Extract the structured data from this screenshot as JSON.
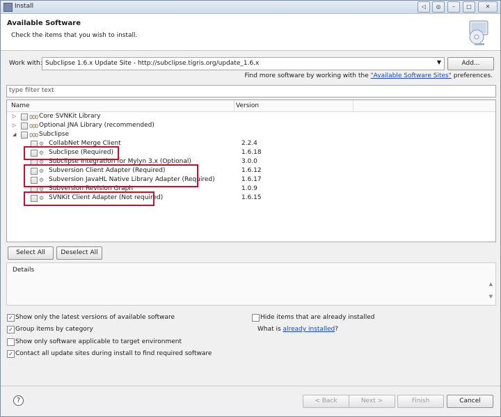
{
  "window": {
    "title": "Install"
  },
  "header": {
    "title": "Available Software",
    "subtitle": "Check the items that you wish to install."
  },
  "workwith": {
    "label": "Work with:",
    "value": "Subclipse 1.6.x Update Site - http://subclipse.tigris.org/update_1.6.x",
    "add_label": "Add..."
  },
  "findmore": {
    "prefix": "Find more software by working with the ",
    "link": "\"Available Software Sites\"",
    "suffix": " preferences."
  },
  "filter": {
    "placeholder": "type filter text"
  },
  "tree": {
    "col_name": "Name",
    "col_version": "Version",
    "rows": [
      {
        "name": "Core SVNKit Library",
        "version": ""
      },
      {
        "name": "Optional JNA Library (recommended)",
        "version": ""
      },
      {
        "name": "Subclipse",
        "version": ""
      },
      {
        "name": "CollabNet Merge Client",
        "version": "2.2.4"
      },
      {
        "name": "Subclipse (Required)",
        "version": "1.6.18"
      },
      {
        "name": "Subclipse Integration for Mylyn 3.x (Optional)",
        "version": "3.0.0"
      },
      {
        "name": "Subversion Client Adapter (Required)",
        "version": "1.6.12"
      },
      {
        "name": "Subversion JavaHL Native Library Adapter (Required)",
        "version": "1.6.17"
      },
      {
        "name": "Subversion Revision Graph",
        "version": "1.0.9"
      },
      {
        "name": "SVNKit Client Adapter (Not required)",
        "version": "1.6.15"
      }
    ]
  },
  "buttons": {
    "select_all": "Select All",
    "deselect_all": "Deselect All"
  },
  "details": {
    "label": "Details"
  },
  "options": {
    "latest": "Show only the latest versions of available software",
    "group": "Group items by category",
    "applicable": "Show only software applicable to target environment",
    "contact": "Contact all update sites during install to find required software",
    "hide": "Hide items that are already installed",
    "what_prefix": "What is ",
    "what_link": "already installed",
    "what_suffix": "?"
  },
  "footer": {
    "back": "< Back",
    "next": "Next >",
    "finish": "Finish",
    "cancel": "Cancel"
  }
}
